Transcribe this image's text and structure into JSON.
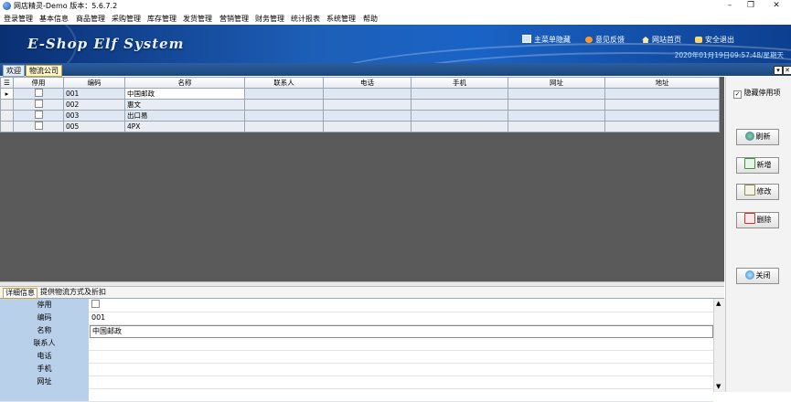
{
  "window": {
    "title": "网店精灵-Demo  版本：5.6.7.2",
    "controls": [
      "–",
      "❐",
      "✕"
    ]
  },
  "menu": [
    "登录管理",
    "基本信息",
    "商品管理",
    "采购管理",
    "库存管理",
    "发货管理",
    "营销管理",
    "财务管理",
    "统计报表",
    "系统管理",
    "帮助"
  ],
  "banner": {
    "logo": "E-Shop Elf System",
    "links": [
      "主菜单隐藏",
      "意见反馈",
      "网站首页",
      "安全退出"
    ],
    "datetime": "2020年01月19日09:57:48/星期天"
  },
  "tabs": [
    "欢迎",
    "物流公司"
  ],
  "grid": {
    "columns": [
      "停用",
      "编码",
      "名称",
      "联系人",
      "电话",
      "手机",
      "网址",
      "地址"
    ],
    "rows": [
      {
        "code": "001",
        "name": "中国邮政"
      },
      {
        "code": "002",
        "name": "惠文"
      },
      {
        "code": "003",
        "name": "出口易"
      },
      {
        "code": "005",
        "name": "4PX"
      }
    ]
  },
  "right_panel": {
    "hide_disabled_label": "隐藏停用项",
    "buttons": [
      "刷新",
      "新增",
      "修改",
      "删除",
      "关闭"
    ]
  },
  "detail_tabs": [
    "详细信息",
    "提供物流方式及折扣"
  ],
  "detail": {
    "labels": [
      "停用",
      "编码",
      "名称",
      "联系人",
      "电话",
      "手机",
      "网址"
    ],
    "code_value": "001",
    "name_value": "中国邮政"
  },
  "colors": {
    "banner": "#1d5fb8",
    "tabstrip": "#1b477e",
    "label_bg": "#b9d0ea"
  }
}
